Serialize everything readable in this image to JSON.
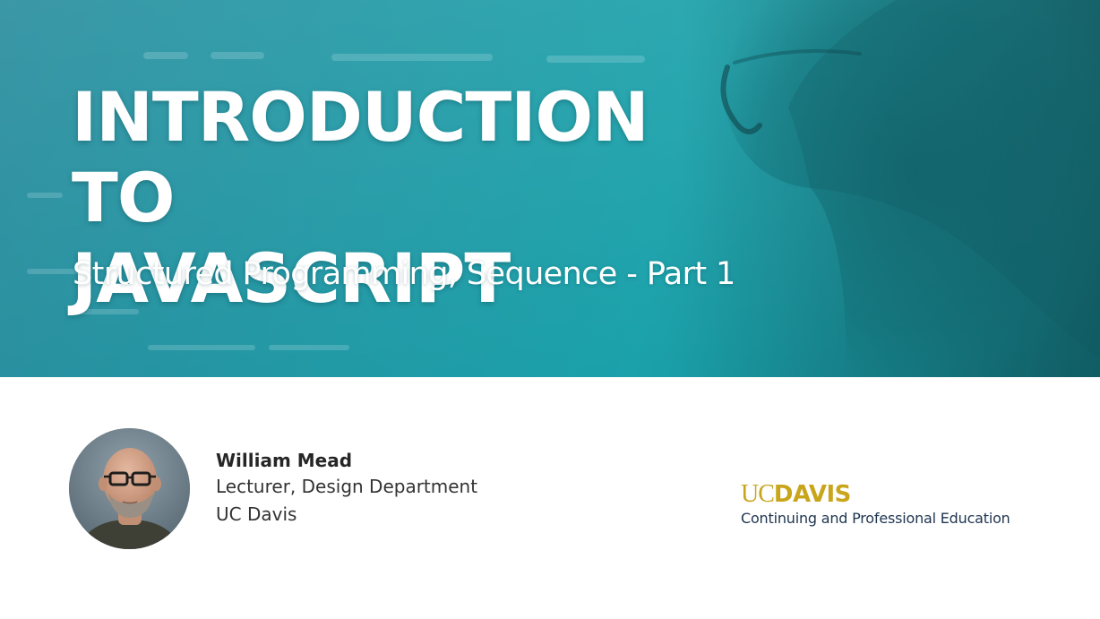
{
  "hero": {
    "title_line1": "INTRODUCTION TO",
    "title_line2": "JAVASCRIPT",
    "subtitle": "Structured Programming, Sequence - Part 1"
  },
  "presenter": {
    "name": "William Mead",
    "role": "Lecturer, Design Department",
    "institution": "UC Davis",
    "avatar_icon": "presenter-photo"
  },
  "logo": {
    "uc": "UC",
    "davis": "DAVIS",
    "tagline": "Continuing and Professional Education"
  },
  "colors": {
    "hero_teal": "#1aa1aa",
    "hero_teal_dark": "#146a72",
    "logo_gold": "#c9a51c",
    "logo_navy": "#1f3550",
    "text_dark": "#2b2b2b"
  }
}
